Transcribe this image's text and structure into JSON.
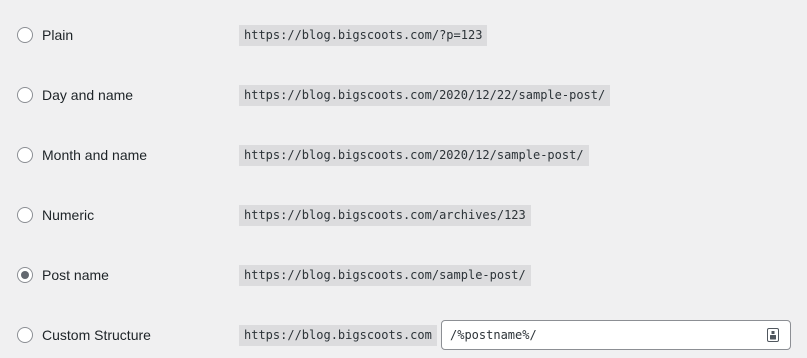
{
  "options": [
    {
      "label": "Plain",
      "example": "https://blog.bigscoots.com/?p=123",
      "checked": false
    },
    {
      "label": "Day and name",
      "example": "https://blog.bigscoots.com/2020/12/22/sample-post/",
      "checked": false
    },
    {
      "label": "Month and name",
      "example": "https://blog.bigscoots.com/2020/12/sample-post/",
      "checked": false
    },
    {
      "label": "Numeric",
      "example": "https://blog.bigscoots.com/archives/123",
      "checked": false
    },
    {
      "label": "Post name",
      "example": "https://blog.bigscoots.com/sample-post/",
      "checked": true
    },
    {
      "label": "Custom Structure",
      "example": "https://blog.bigscoots.com",
      "checked": false
    }
  ],
  "custom_structure": {
    "value": "/%postname%/",
    "icon": "password-manager-icon"
  },
  "colors": {
    "background": "#f0f0f1",
    "code_background": "#dcdcde",
    "radio_border": "#8c8f94",
    "radio_dot": "#646970",
    "text": "#1d2327"
  }
}
